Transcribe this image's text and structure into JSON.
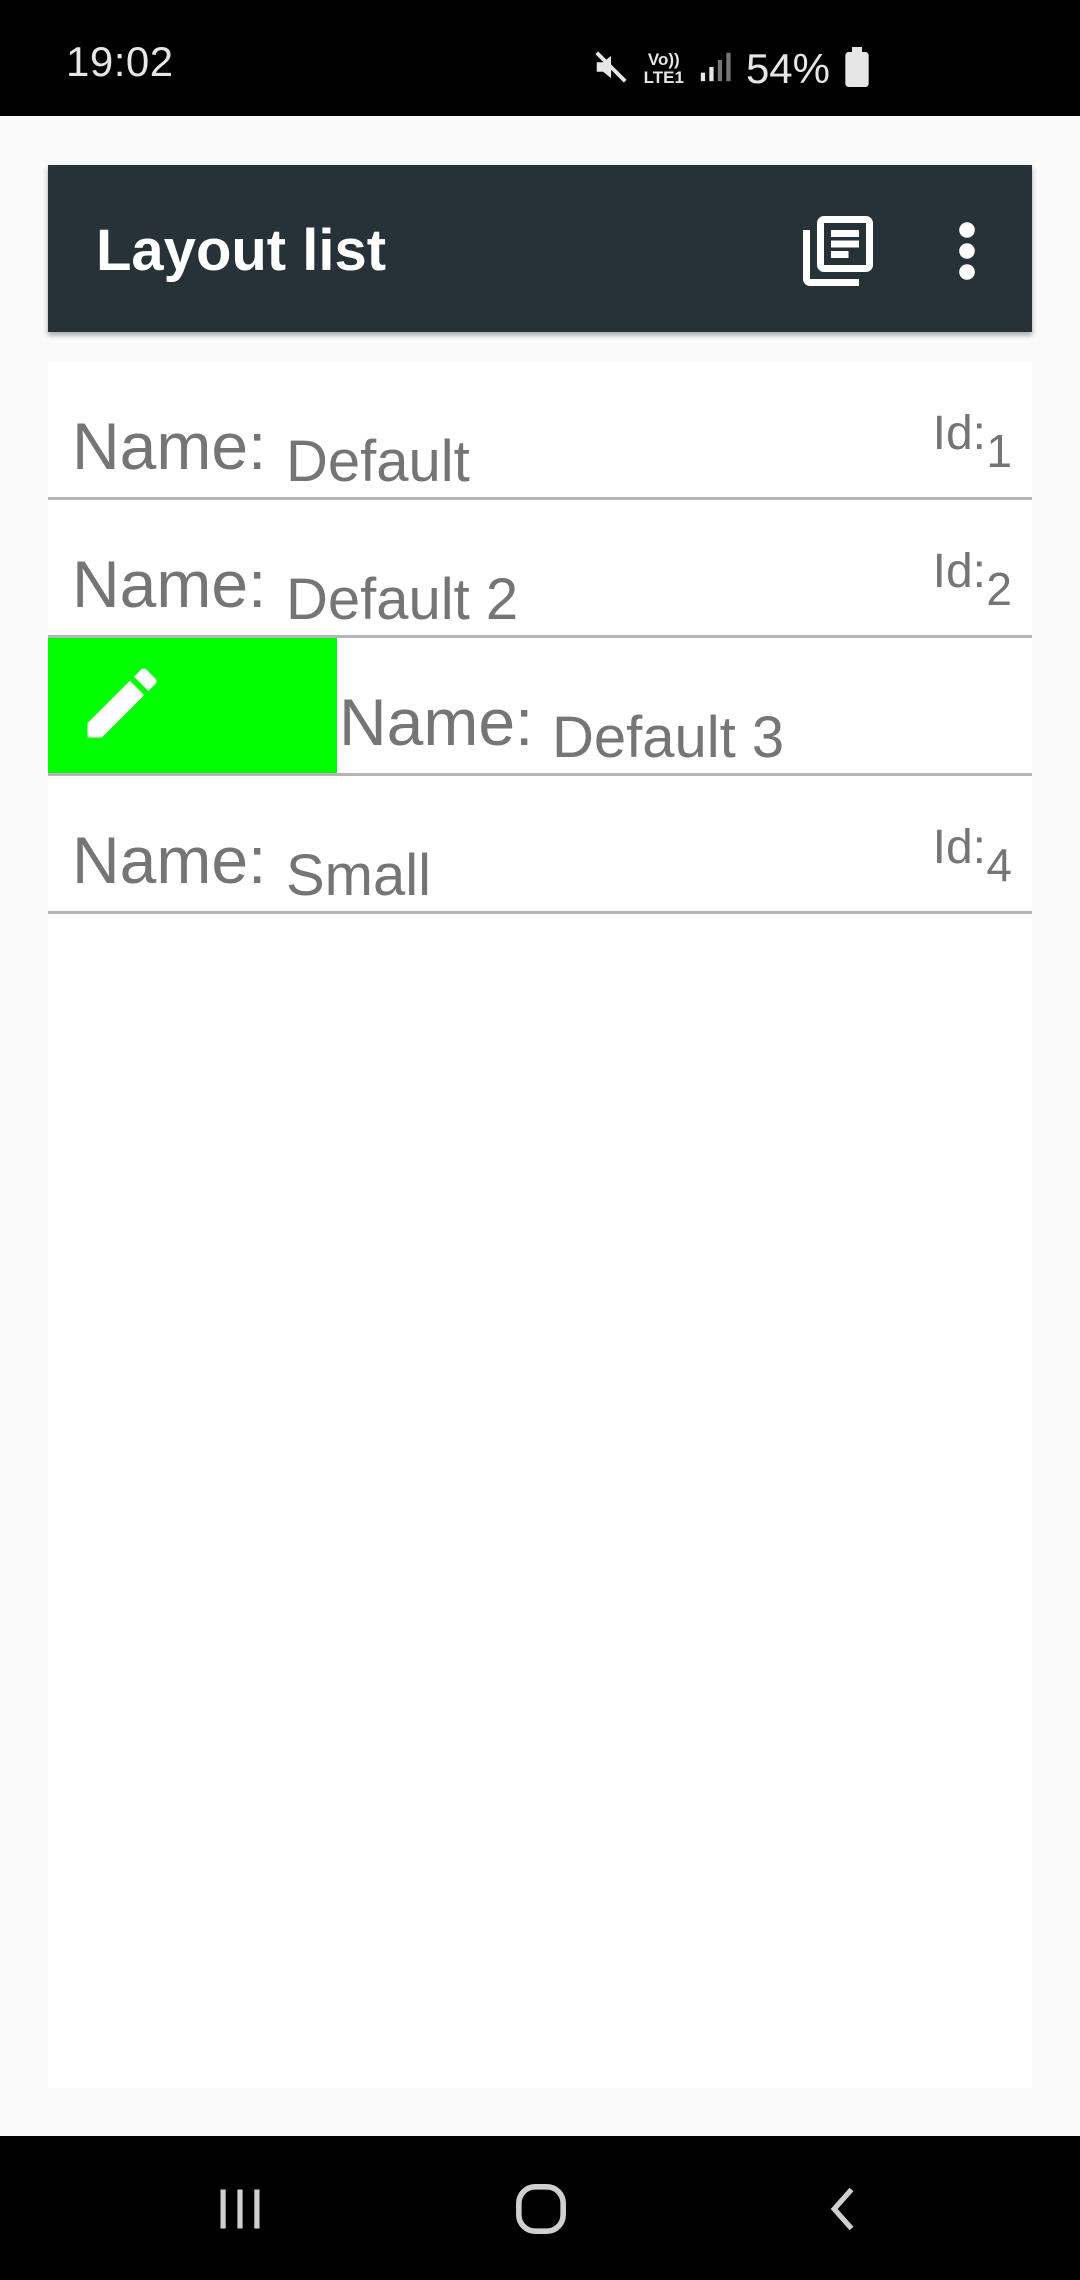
{
  "status_bar": {
    "time": "19:02",
    "network_label_top": "Vo))",
    "network_label_bottom": "LTE1",
    "battery_percent": "54%",
    "icons": [
      "mute-icon",
      "signal-icon",
      "battery-icon"
    ]
  },
  "app_bar": {
    "title": "Layout list",
    "background": "#263238",
    "actions": [
      "layout-list-icon",
      "more-vert-icon"
    ]
  },
  "list": {
    "items": [
      {
        "name_label": "Name:",
        "name_value": "Default",
        "id_label": "Id:",
        "id_value": "1"
      },
      {
        "name_label": "Name:",
        "name_value": "Default 2",
        "id_label": "Id:",
        "id_value": "2"
      },
      {
        "name_label": "Name:",
        "name_value": "Default 3",
        "swipe_action": "edit-icon",
        "swipe_color": "#00ff00"
      },
      {
        "name_label": "Name:",
        "name_value": "Small",
        "id_label": "Id:",
        "id_value": "4"
      }
    ]
  },
  "nav_bar": {
    "buttons": [
      "recents-icon",
      "home-icon",
      "back-icon"
    ]
  }
}
